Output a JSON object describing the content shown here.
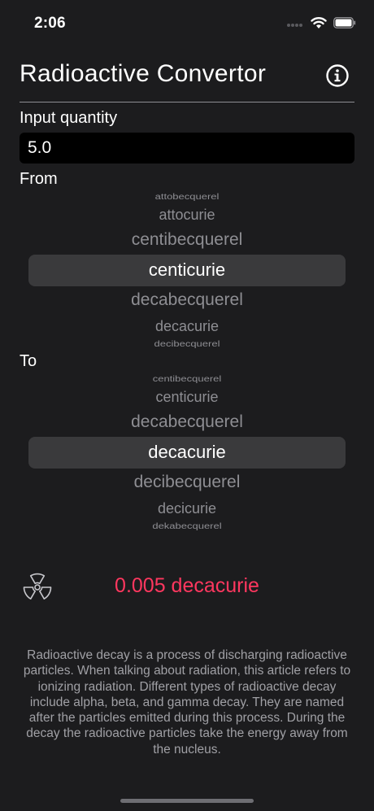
{
  "status_bar": {
    "time": "2:06",
    "icons": [
      "signal-dots-icon",
      "wifi-icon",
      "battery-icon"
    ]
  },
  "nav": {
    "title": "Radioactive Convertor",
    "info_icon": "info-circle-icon"
  },
  "input": {
    "label": "Input quantity",
    "value": "5.0"
  },
  "from": {
    "label": "From",
    "options": [
      "attobecquerel",
      "attocurie",
      "centibecquerel",
      "centicurie",
      "decabecquerel",
      "decacurie",
      "decibecquerel"
    ],
    "selected": "centicurie"
  },
  "to": {
    "label": "To",
    "options": [
      "centibecquerel",
      "centicurie",
      "decabecquerel",
      "decacurie",
      "decibecquerel",
      "decicurie",
      "dekabecquerel"
    ],
    "selected": "decacurie"
  },
  "result": {
    "icon": "radiation-icon",
    "value": "0.005 decacurie"
  },
  "description": "Radioactive decay is a process of discharging radioactive particles. When talking about radiation, this article refers to ionizing radiation. Different types of radioactive decay include alpha, beta, and gamma decay. They are named after the particles emitted during this process. During the decay the radioactive particles take the energy away from the nucleus.",
  "colors": {
    "background": "#1c1c1e",
    "accent": "#ff375f",
    "picker_highlight": "#3a3a3c",
    "secondary_text": "#8e8e93"
  }
}
